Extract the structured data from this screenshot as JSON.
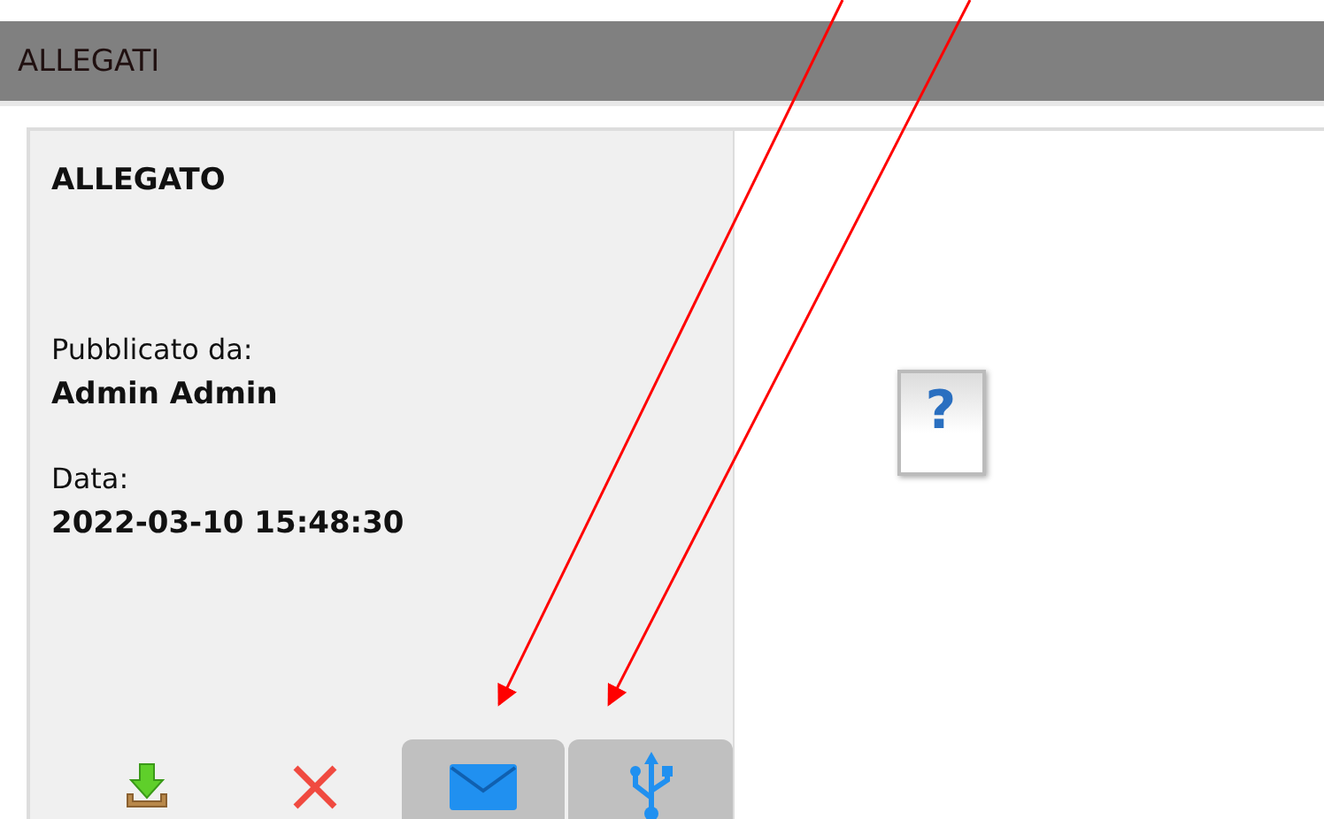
{
  "header": {
    "title": "ALLEGATI"
  },
  "attachment": {
    "title": "ALLEGATO",
    "fields": [
      {
        "label": "Pubblicato da:",
        "value": "Admin Admin"
      },
      {
        "label": "Data:",
        "value": "2022-03-10 15:48:30"
      }
    ]
  },
  "actions": [
    {
      "kind": "download",
      "highlighted": false
    },
    {
      "kind": "delete",
      "highlighted": false
    },
    {
      "kind": "email",
      "highlighted": true
    },
    {
      "kind": "usb",
      "highlighted": true
    }
  ],
  "preview": {
    "glyph": "?"
  }
}
